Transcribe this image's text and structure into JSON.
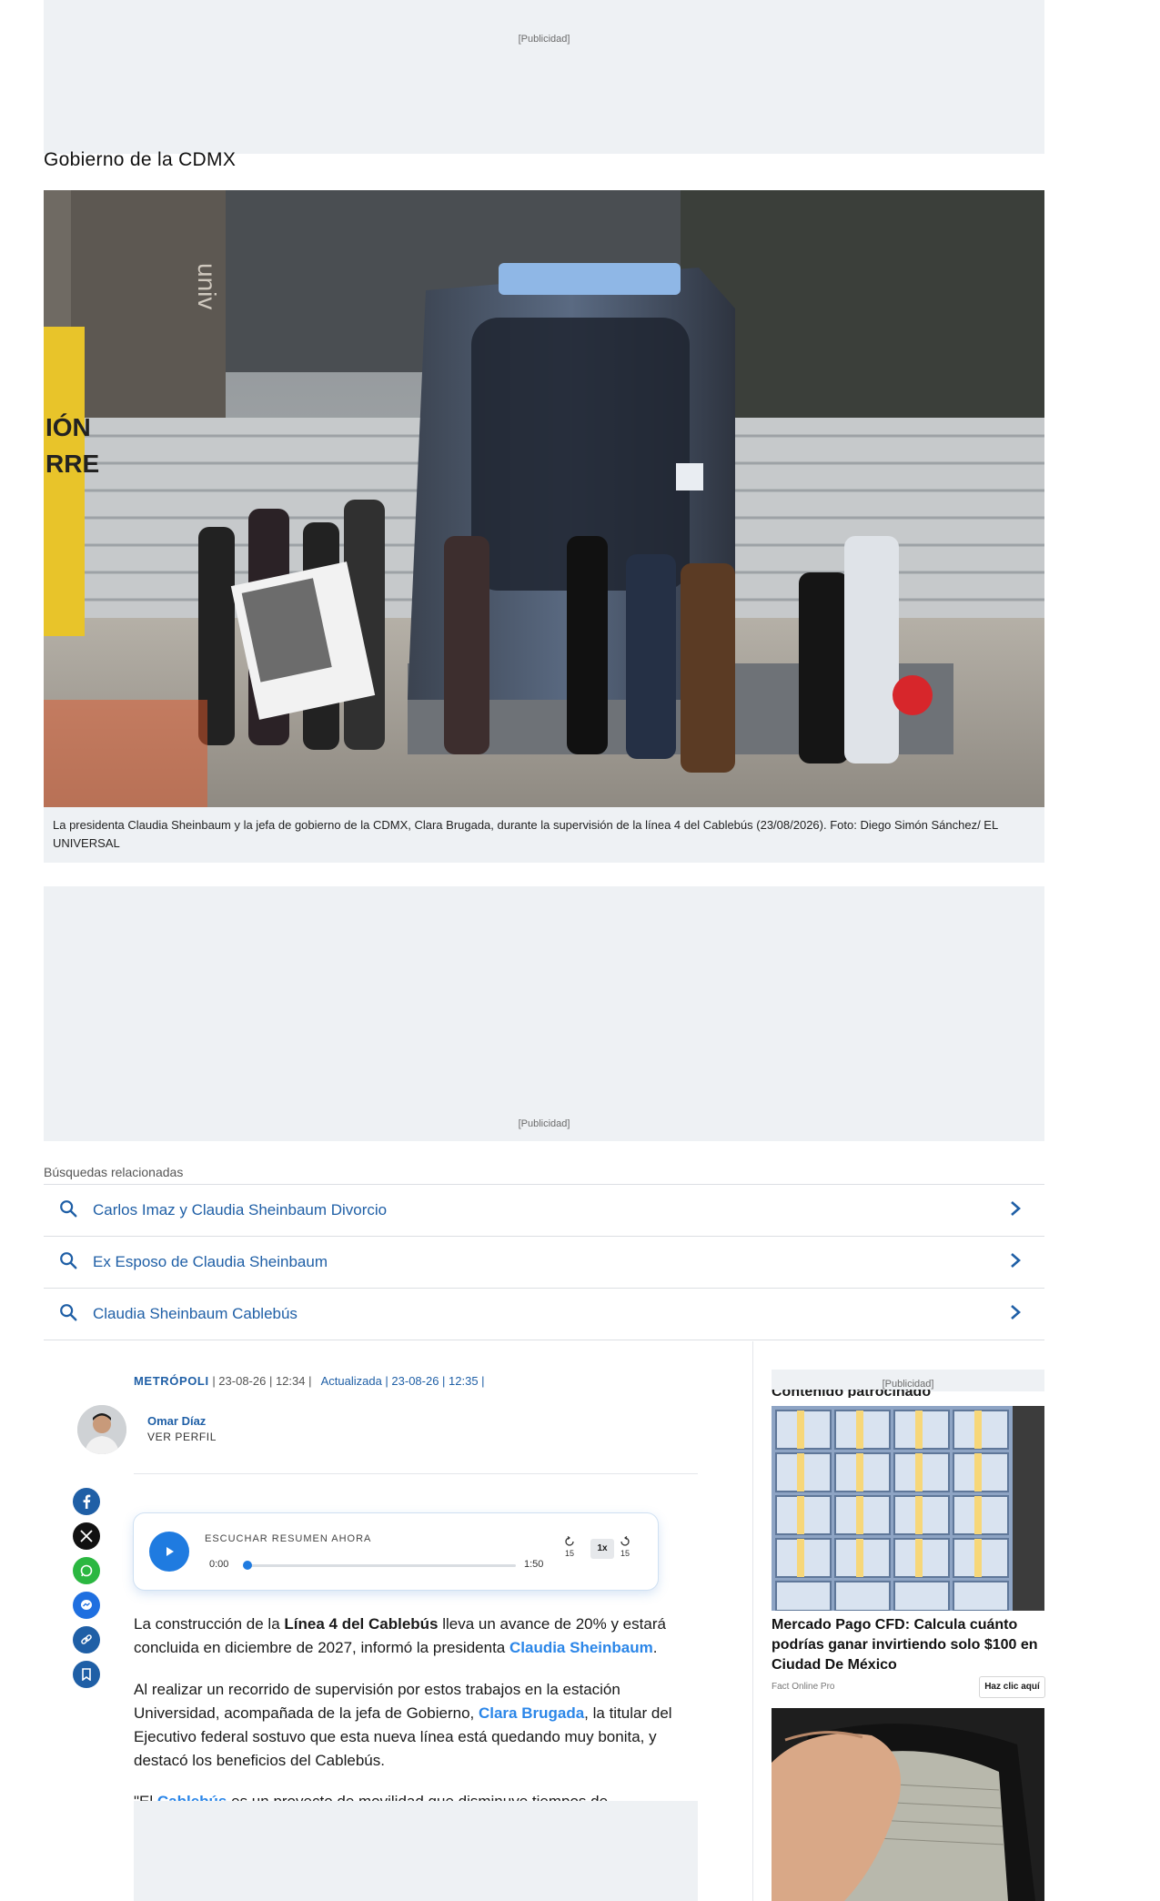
{
  "ads": {
    "top_label": "[Publicidad]",
    "mid_label": "[Publicidad]",
    "sidebar_label": "[Publicidad]"
  },
  "section": {
    "title": "Gobierno de la CDMX"
  },
  "hero": {
    "caption": "La presidenta Claudia Sheinbaum y la jefa de gobierno de la CDMX, Clara Brugada, durante la supervisión de la línea 4 del Cablebús (23/08/2026). Foto: Diego Simón Sánchez/ EL UNIVERSAL"
  },
  "related": {
    "title": "Búsquedas relacionadas",
    "items": [
      {
        "label": "Carlos Imaz y Claudia Sheinbaum Divorcio"
      },
      {
        "label": "Ex Esposo de Claudia Sheinbaum"
      },
      {
        "label": "Claudia Sheinbaum Cablebús"
      }
    ]
  },
  "article": {
    "section": "METRÓPOLI",
    "date": "| 23-08-26 | 12:34 |",
    "updated": "Actualizada | 23-08-26 | 12:35 |",
    "author": {
      "name": "Omar Díaz",
      "profile_link": "VER PERFIL"
    },
    "player": {
      "label": "ESCUCHAR RESUMEN AHORA",
      "current_time": "0:00",
      "duration": "1:50",
      "back_seconds": "15",
      "forward_seconds": "15",
      "speed": "1x",
      "progress": 0.0
    },
    "p1": {
      "a": "La construcción de la ",
      "b": "Línea 4 del Cablebús",
      "c": " lleva un avance de 20% y estará concluida en diciembre de 2027, informó la presidenta ",
      "d": "Claudia Sheinbaum",
      "e": "."
    },
    "p2": {
      "a": "Al realizar un recorrido de supervisión por estos trabajos en la estación Universidad, acompañada de la jefa de Gobierno, ",
      "b": "Clara Brugada",
      "c": ", la titular del Ejecutivo federal sostuvo que esta nueva línea está quedando muy bonita, y destacó los beneficios del Cablebús."
    },
    "p3": {
      "a": "\"El ",
      "b": "Cablebús",
      "c": " es un proyecto de movilidad que disminuye tiempos de"
    }
  },
  "share": [
    "facebook-icon",
    "x-icon",
    "whatsapp-icon",
    "messenger-icon",
    "link-icon",
    "bookmark-icon"
  ],
  "sidebar": {
    "cut_heading": "Contenido patrocinado",
    "card1": {
      "title": "Mercado Pago CFD: Calcula cuánto podrías ganar invirtiendo solo $100 en Ciudad De México",
      "source": "Fact Online Pro",
      "cta": "Haz clic aquí"
    }
  },
  "colors": {
    "accent": "#1f5fa6",
    "link": "#2b86e8",
    "player": "#1f7be0",
    "ad_bg": "#eef1f4"
  }
}
